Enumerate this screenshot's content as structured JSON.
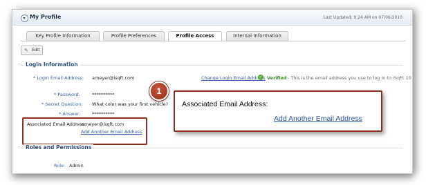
{
  "panel": {
    "title": "My Profile",
    "last_updated": "Last Updated: 9:24 AM on 07/06/2010"
  },
  "tabs": [
    {
      "label": "Key Profile Information",
      "active": false
    },
    {
      "label": "Profile Preferences",
      "active": false
    },
    {
      "label": "Profile Access",
      "active": true
    },
    {
      "label": "Internal Information",
      "active": false
    }
  ],
  "toolbar": {
    "edit_label": "Edit",
    "edit_icon": "pencil-icon"
  },
  "login": {
    "section_title": "Login Information",
    "login_email_label": "* Login Email Address:",
    "login_email_value": "ameyer@isqft.com",
    "change_link": "Change Login Email Address",
    "verified": "Verified",
    "verified_desc": "- This is the email address you use to log in to iSqFt 10",
    "password_label": "* Password:",
    "password_value": "**********",
    "secret_question_label": "* Secret Question:",
    "secret_question_value": "What color was your first vehicle?",
    "answer_label": "* Answer:",
    "answer_value": "**********",
    "assoc_email_label": "Associated Email Address:",
    "assoc_email_value": "ameyer@isqft.com",
    "add_another_link": "Add Another Email Address"
  },
  "roles": {
    "section_title": "Roles and Permissions",
    "role_label": "Role:",
    "role_value": "Admin"
  },
  "callout": {
    "marker": "1",
    "label": "Associated Email Address:",
    "link": "Add Another Email Address",
    "accent": "#8b2f1e"
  }
}
